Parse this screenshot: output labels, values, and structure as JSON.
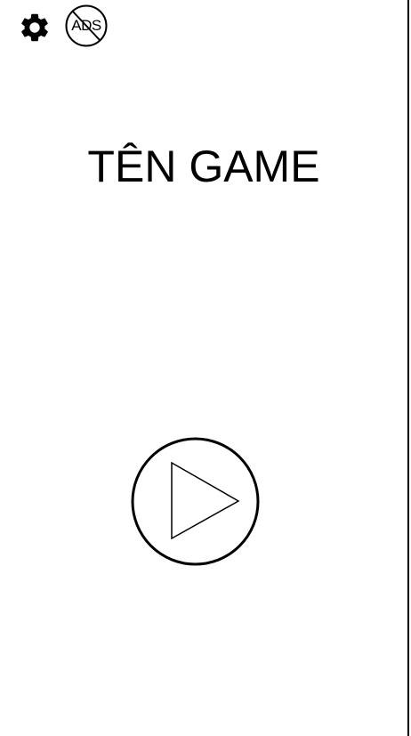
{
  "header": {
    "settings_icon": "gear-icon",
    "no_ads_icon": "no-ads-icon",
    "no_ads_label": "ADS"
  },
  "main": {
    "title": "TÊN GAME",
    "play_icon": "play-icon"
  },
  "colors": {
    "background": "#ffffff",
    "foreground": "#000000"
  }
}
